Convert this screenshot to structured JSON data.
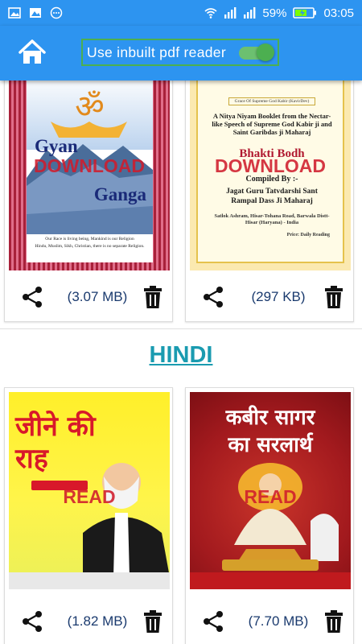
{
  "status_bar": {
    "battery": "59%",
    "time": "03:05"
  },
  "app_bar": {
    "home_icon": "home-icon",
    "pdf_toggle_label": "Use inbuilt pdf reader",
    "pdf_toggle_on": true
  },
  "colors": {
    "primary": "#2d94f0",
    "accent_green": "#4caf50",
    "overlay_red": "#d01c2c",
    "section_title": "#1a9bb0",
    "size_text": "#1a3a6e"
  },
  "english_books": [
    {
      "overlay": "DOWNLOAD",
      "size": "(3.07 MB)",
      "cover": {
        "title_line1": "Gyan",
        "title_line2": "Ganga",
        "om": "ॐ",
        "footer1": "Our Race is living being, Mankind is our Religion",
        "footer2": "Hindu, Muslim, Sikh, Christian, there is no separate Religion."
      }
    },
    {
      "overlay": "DOWNLOAD",
      "size": "(297 KB)",
      "cover": {
        "top": "Grace Of Supreme God Kabir (KavirDev)",
        "desc": "A Nitya Niyam Booklet from the Nectar-like Speech of Supreme God Kabir ji and Saint Garibdas ji Maharaj",
        "title": "Bhakti Bodh",
        "compiled": "Compiled By :-",
        "author": "Jagat Guru Tatvdarshi Sant Rampal Dass Ji Maharaj",
        "address": "Satlok Ashram, Hisar-Tohana Road, Barwala Distt-Hisar (Haryana) - India",
        "price": "Price: Daily Reading"
      }
    }
  ],
  "section_title": "HINDI",
  "hindi_books": [
    {
      "overlay": "READ",
      "size": "(1.82 MB)",
      "cover": {
        "title_line1": "जीने की",
        "title_line2": "राह"
      }
    },
    {
      "overlay": "READ",
      "size": "(7.70 MB)",
      "cover": {
        "title_line1": "कबीर सागर",
        "title_line2": "का सरलार्थ"
      }
    }
  ]
}
